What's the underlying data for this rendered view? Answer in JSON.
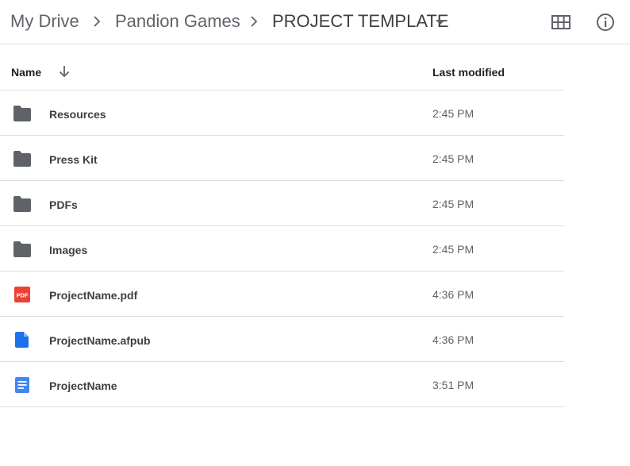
{
  "breadcrumb": {
    "items": [
      "My Drive",
      "Pandion Games",
      "PROJECT TEMPLATE"
    ]
  },
  "toolbar": {
    "grid_view_icon": "grid-view-icon",
    "info_icon": "info-icon"
  },
  "table": {
    "columns": [
      "Name",
      "Last modified"
    ],
    "sort": "descending",
    "rows": [
      {
        "name": "Resources",
        "modified": "2:45 PM",
        "icon": "folder-icon"
      },
      {
        "name": "Press Kit",
        "modified": "2:45 PM",
        "icon": "folder-icon"
      },
      {
        "name": "PDFs",
        "modified": "2:45 PM",
        "icon": "folder-icon"
      },
      {
        "name": "Images",
        "modified": "2:45 PM",
        "icon": "folder-icon"
      },
      {
        "name": "ProjectName.pdf",
        "modified": "4:36 PM",
        "icon": "pdf-icon"
      },
      {
        "name": "ProjectName.afpub",
        "modified": "4:36 PM",
        "icon": "file-icon"
      },
      {
        "name": "ProjectName",
        "modified": "3:51 PM",
        "icon": "google-doc-icon"
      }
    ]
  },
  "colors": {
    "folder": "#5f6368",
    "pdf": "#ea4335",
    "file": "#1a73e8",
    "doc": "#4285f4",
    "divider": "#dadce0"
  },
  "pdf_icon_text": "PDF"
}
